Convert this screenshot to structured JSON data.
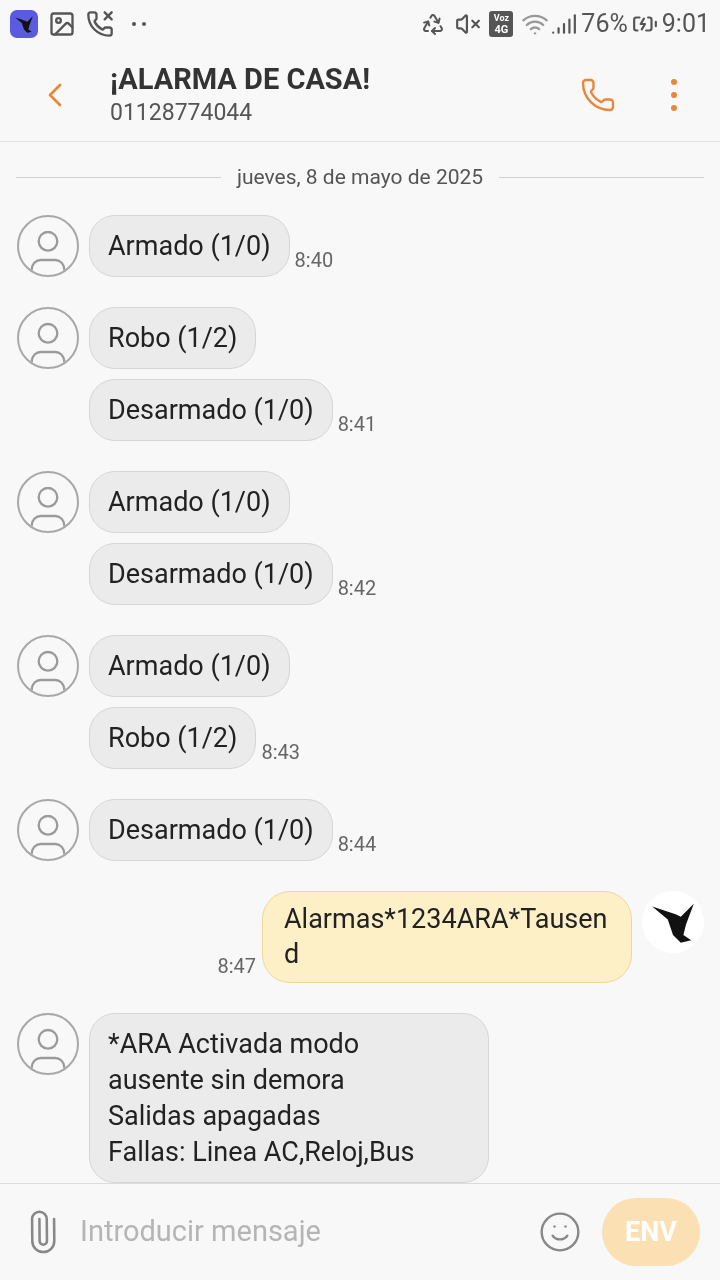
{
  "status_bar": {
    "badge_top": "Voz",
    "badge_bottom": "4G",
    "battery": "76%",
    "time": "9:01"
  },
  "header": {
    "title": "¡ALARMA DE CASA!",
    "subtitle": "01128774044"
  },
  "date_divider": "jueves, 8 de mayo de 2025",
  "groups": [
    {
      "kind": "received",
      "bubbles": [
        "Armado (1/0)"
      ],
      "time": "8:40"
    },
    {
      "kind": "received",
      "bubbles": [
        "Robo (1/2)",
        "Desarmado (1/0)"
      ],
      "time": "8:41"
    },
    {
      "kind": "received",
      "bubbles": [
        "Armado (1/0)",
        "Desarmado (1/0)"
      ],
      "time": "8:42"
    },
    {
      "kind": "received",
      "bubbles": [
        "Armado (1/0)",
        "Robo (1/2)"
      ],
      "time": "8:43"
    },
    {
      "kind": "received",
      "bubbles": [
        "Desarmado (1/0)"
      ],
      "time": "8:44"
    },
    {
      "kind": "sent",
      "bubbles": [
        "Alarmas*1234ARA*Tausend"
      ],
      "time": "8:47"
    },
    {
      "kind": "received",
      "bubbles": [
        "*ARA Activada modo\nausente sin demora\nSalidas apagadas\nFallas: Linea AC,Reloj,Bus"
      ]
    }
  ],
  "composer": {
    "placeholder": "Introducir mensaje",
    "send": {
      "label": "ENV",
      "disabled": true
    }
  }
}
